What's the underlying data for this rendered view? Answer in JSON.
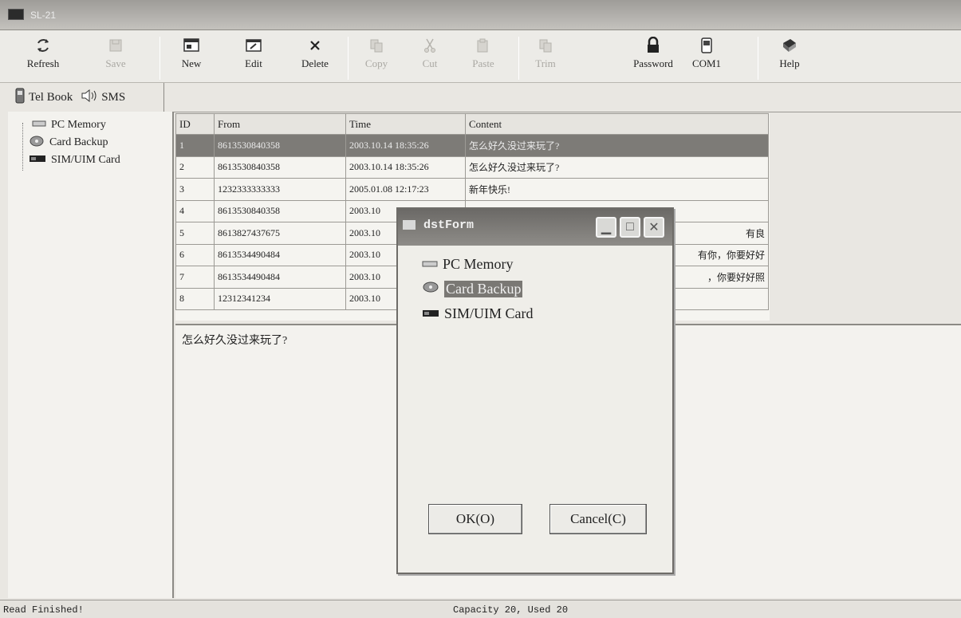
{
  "window": {
    "title": "SL-21"
  },
  "toolbar": {
    "refresh": "Refresh",
    "save": "Save",
    "new": "New",
    "edit": "Edit",
    "delete": "Delete",
    "copy": "Copy",
    "cut": "Cut",
    "paste": "Paste",
    "trim": "Trim",
    "password": "Password",
    "com": "COM1",
    "help": "Help"
  },
  "tabs": {
    "telbook": "Tel Book",
    "sms": "SMS"
  },
  "tree": {
    "pc_memory": "PC Memory",
    "card_backup": "Card Backup",
    "sim_card": "SIM/UIM Card"
  },
  "table": {
    "headers": {
      "id": "ID",
      "from": "From",
      "time": "Time",
      "content": "Content"
    },
    "rows": [
      {
        "id": "1",
        "from": "8613530840358",
        "time": "2003.10.14 18:35:26",
        "content": "怎么好久没过来玩了?"
      },
      {
        "id": "2",
        "from": "8613530840358",
        "time": "2003.10.14 18:35:26",
        "content": "怎么好久没过来玩了?"
      },
      {
        "id": "3",
        "from": "1232333333333",
        "time": "2005.01.08 12:17:23",
        "content": "新年快乐!"
      },
      {
        "id": "4",
        "from": "8613530840358",
        "time": "2003.10",
        "content": ""
      },
      {
        "id": "5",
        "from": "8613827437675",
        "time": "2003.10",
        "content": "有良"
      },
      {
        "id": "6",
        "from": "8613534490484",
        "time": "2003.10",
        "content": "有你，你要好好"
      },
      {
        "id": "7",
        "from": "8613534490484",
        "time": "2003.10",
        "content": "，你要好好照"
      },
      {
        "id": "8",
        "from": "12312341234",
        "time": "2003.10",
        "content": ""
      }
    ]
  },
  "preview": {
    "text": "怎么好久没过来玩了?"
  },
  "status": {
    "left": "Read Finished!",
    "center": "Capacity 20, Used 20"
  },
  "dialog": {
    "title": "dstForm",
    "items": {
      "pc_memory": "PC Memory",
      "card_backup": "Card Backup",
      "sim_card": "SIM/UIM Card"
    },
    "ok": "OK(O)",
    "cancel": "Cancel(C)"
  }
}
